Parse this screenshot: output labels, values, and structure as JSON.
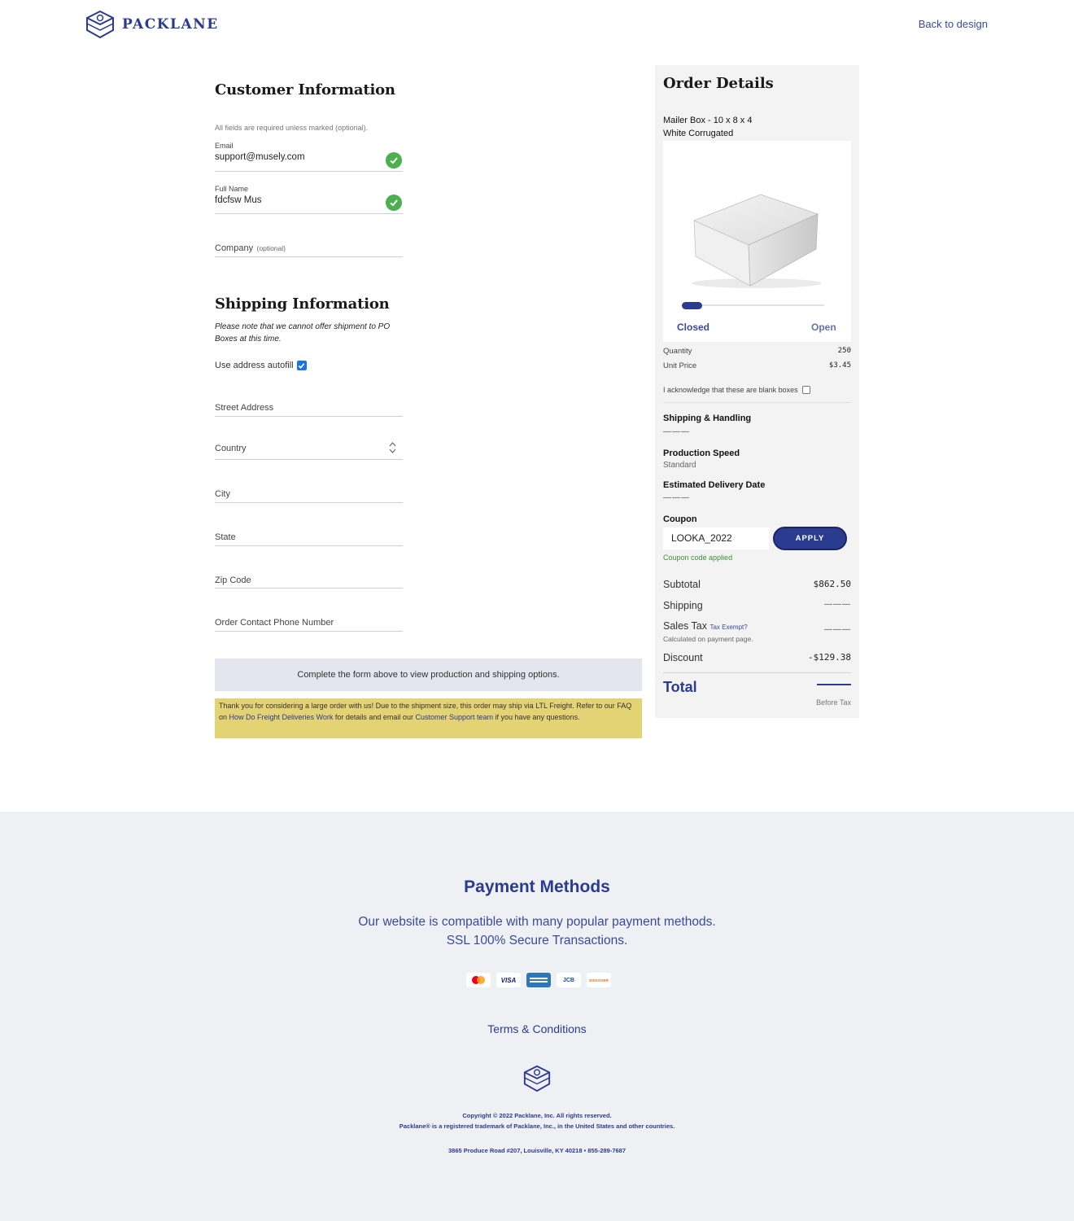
{
  "header": {
    "brand": "PACKLANE",
    "back_link": "Back to design"
  },
  "customer": {
    "title": "Customer Information",
    "required_note": "All fields are required unless marked (optional).",
    "email_label": "Email",
    "email_value": "support@musely.com",
    "fullname_label": "Full Name",
    "fullname_value": "fdcfsw Mus",
    "company_label": "Company",
    "company_optional": "(optional)"
  },
  "shipping": {
    "title": "Shipping Information",
    "note": "Please note that we cannot offer shipment to PO Boxes at this time.",
    "autofill_label": "Use address autofill",
    "autofill_checked": true,
    "street": "Street Address",
    "country": "Country",
    "city": "City",
    "state": "State",
    "zip": "Zip Code",
    "phone": "Order Contact Phone Number"
  },
  "notices": {
    "complete_form": "Complete the form above to view production and shipping options.",
    "freight_1": "Thank you for considering a large order with us! Due to the shipment size, this order may ship via LTL Freight. Refer to our FAQ on ",
    "freight_link1": "How Do Freight Deliveries Work",
    "freight_2": " for details and email our ",
    "freight_link2": "Customer Support team",
    "freight_3": " if you have any questions."
  },
  "order": {
    "title": "Order Details",
    "product_line1": "Mailer Box - 10 x 8 x 4",
    "product_line2": "White Corrugated",
    "slider_closed": "Closed",
    "slider_open": "Open",
    "slider_position": 0,
    "quantity_label": "Quantity",
    "quantity_value": "250",
    "unit_price_label": "Unit Price",
    "unit_price_value": "$3.45",
    "ack_label": "I acknowledge that these are blank boxes",
    "shipping_handling_label": "Shipping & Handling",
    "shipping_handling_value": "———",
    "production_speed_label": "Production Speed",
    "production_speed_value": "Standard",
    "delivery_label": "Estimated Delivery Date",
    "delivery_value": "———",
    "coupon_label": "Coupon",
    "coupon_value": "LOOKA_2022",
    "apply_label": "APPLY",
    "coupon_applied": "Coupon code applied",
    "subtotal_label": "Subtotal",
    "subtotal_value": "$862.50",
    "shipping_label": "Shipping",
    "shipping_value": "———",
    "tax_label": "Sales Tax",
    "tax_exempt": "Tax Exempt?",
    "tax_value": "———",
    "tax_note": "Calculated on payment page.",
    "discount_label": "Discount",
    "discount_value": "-$129.38",
    "total_label": "Total",
    "before_tax": "Before Tax"
  },
  "footer": {
    "title": "Payment Methods",
    "desc": "Our website is compatible with many popular payment methods. SSL 100% Secure Transactions.",
    "cards": [
      "mastercard-icon",
      "visa-icon",
      "amex-icon",
      "jcb-icon",
      "discover-icon"
    ],
    "card_visa": "VISA",
    "card_discover": "DISCOVER",
    "card_jcb": "JCB",
    "terms": "Terms & Conditions",
    "copyright": "Copyright © 2022 Packlane, Inc. All rights reserved.",
    "trademark": "Packlane® is a registered trademark of Packlane, Inc., in the United States and other countries.",
    "address": "3865 Produce Road #207, Louisville, KY 40218 • 855-289-7687"
  },
  "colors": {
    "brand": "#2b3b8f",
    "success": "#4caf50",
    "notice": "#e4d374"
  }
}
